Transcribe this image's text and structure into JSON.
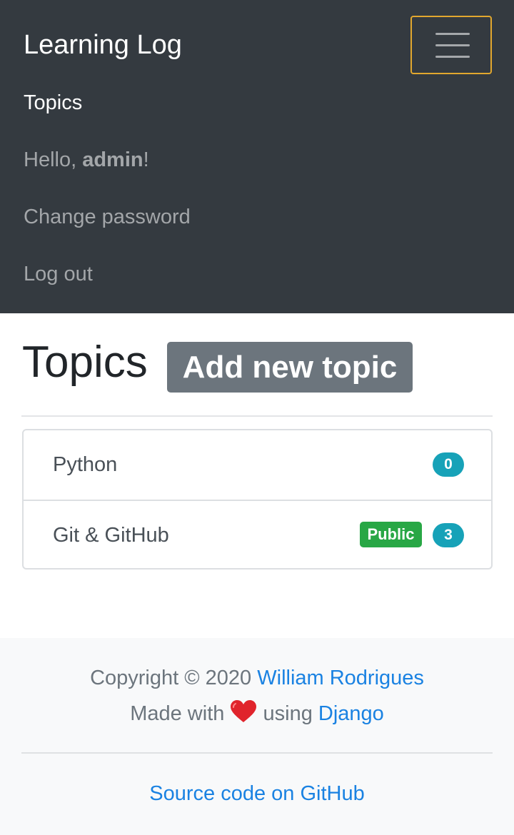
{
  "navbar": {
    "brand": "Learning Log",
    "links": {
      "topics": "Topics",
      "greeting_prefix": "Hello, ",
      "username": "admin",
      "greeting_suffix": "!",
      "change_password": "Change password",
      "logout": "Log out"
    },
    "toggler_icon": "hamburger-menu-icon"
  },
  "main": {
    "title": "Topics",
    "add_button": "Add new topic",
    "topics": [
      {
        "name": "Python",
        "count": "0",
        "public": false
      },
      {
        "name": "Git & GitHub",
        "count": "3",
        "public": true,
        "public_label": "Public"
      }
    ]
  },
  "footer": {
    "copyright_prefix": "Copyright © 2020 ",
    "author": "William Rodrigues",
    "made_with_prefix": "Made with ",
    "heart_icon": "heart-icon",
    "made_with_middle": " using ",
    "framework": "Django",
    "source_link": "Source code on GitHub"
  },
  "colors": {
    "navbar_bg": "#343a40",
    "toggler_border": "#e2a72e",
    "button_secondary": "#6c757d",
    "badge_info": "#17a2b8",
    "badge_success": "#28a745",
    "link": "#1a82e2",
    "heart": "#e0242c",
    "footer_bg": "#f8f9fa"
  }
}
